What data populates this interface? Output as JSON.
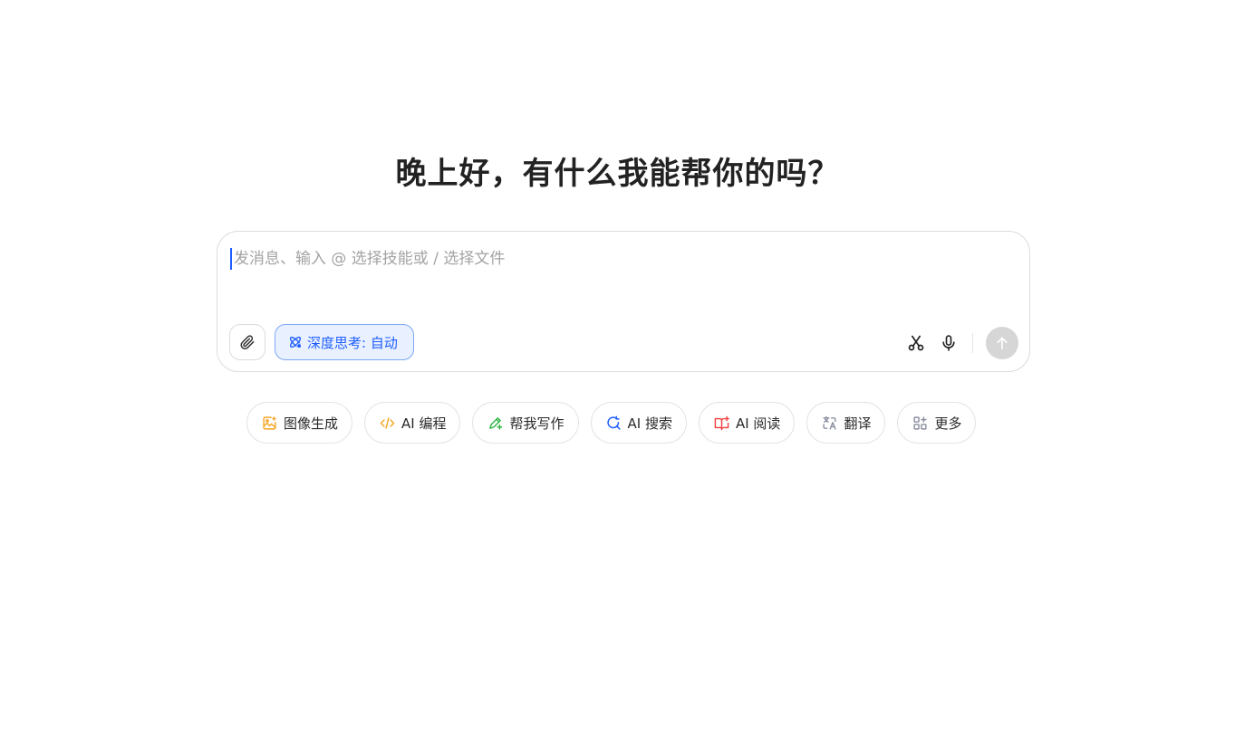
{
  "greeting": "晚上好，有什么我能帮你的吗？",
  "composer": {
    "placeholder": "发消息、输入 @ 选择技能或 / 选择文件",
    "value": "",
    "deep_think_label": "深度思考: 自动"
  },
  "skills": [
    {
      "label": "图像生成",
      "icon": "image-generate-icon",
      "color": "#f5a524"
    },
    {
      "label": "AI 编程",
      "icon": "code-icon",
      "color": "#f5a524"
    },
    {
      "label": "帮我写作",
      "icon": "pen-write-icon",
      "color": "#2fb344"
    },
    {
      "label": "AI 搜索",
      "icon": "search-refresh-icon",
      "color": "#1f5eff"
    },
    {
      "label": "AI 阅读",
      "icon": "book-icon",
      "color": "#f23d3d"
    },
    {
      "label": "翻译",
      "icon": "translate-icon",
      "color": "#8a8fa0"
    },
    {
      "label": "更多",
      "icon": "more-apps-icon",
      "color": "#8a8fa0"
    }
  ],
  "colors": {
    "accent": "#1f5eff",
    "deep_think_bg": "#e9f0ff",
    "send_disabled": "#d6d6d6"
  }
}
